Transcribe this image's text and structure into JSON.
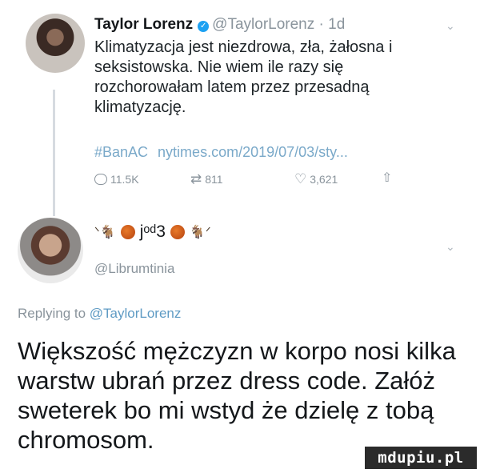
{
  "tweet1": {
    "display_name": "Taylor Lorenz",
    "handle_time": "@TaylorLorenz · 1d",
    "text": "Klimatyzacja jest niezdrowa, zła, żałosna i seksistowska. Nie wiem ile razy się rozchorowałam latem przez przesadną klimatyzację.",
    "hashtag": "#BanAC",
    "link": "nytimes.com/2019/07/03/sty...",
    "replies": "11.5K",
    "retweets": "811",
    "likes": "3,621",
    "icons": {
      "verified": "verified-badge-icon",
      "reply": "reply-bubble-icon",
      "retweet": "retweet-icon",
      "like": "heart-icon",
      "share": "share-icon",
      "menu": "chevron-down-icon"
    }
  },
  "tweet2": {
    "display_name_text": "jᵒᵈ3",
    "handle": "@Librumtinia",
    "replying_prefix": "Replying to",
    "replying_to": "@TaylorLorenz",
    "text": "Większość mężczyzn w korpo nosi kilka warstw ubrań przez dress code. Załóż sweterek bo mi wstyd że dzielę z tobą chromosom."
  },
  "watermark": "mdupiu.pl",
  "colors": {
    "link": "#7aa9c9",
    "muted": "#8a949c",
    "verified": "#1da1f2"
  }
}
